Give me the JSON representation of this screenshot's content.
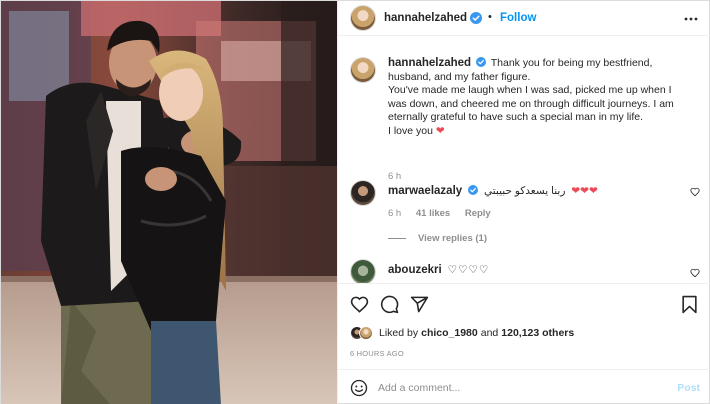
{
  "post": {
    "author": {
      "username": "hannahelzahed",
      "verified": true,
      "follow_label": "Follow",
      "separator": "•"
    },
    "caption": {
      "username": "hannahelzahed",
      "text": "Thank you for being my bestfriend, husband, and my father figure.\nYou've made me laugh when I was sad, picked me up when I was down, and cheered me on through difficult journeys. I am eternally grateful to have such a special man in my life.\nI love you",
      "emoji": "❤",
      "time": "6 h"
    },
    "comments": [
      {
        "username": "marwaelazaly",
        "verified": true,
        "text": "ربنا يسعدكو حبيبتي",
        "emoji": "❤❤❤",
        "time": "6 h",
        "likes": "41 likes",
        "reply_label": "Reply",
        "view_replies": "View replies (1)"
      },
      {
        "username": "abouzekri",
        "verified": false,
        "text": "",
        "emoji": "♡♡♡♡"
      }
    ],
    "likes": {
      "prefix": "Liked by",
      "user": "chico_1980",
      "and": "and",
      "count": "120,123 others"
    },
    "timestamp": "6 HOURS AGO",
    "add_comment": {
      "placeholder": "Add a comment...",
      "post_label": "Post"
    },
    "icons": {
      "more": "more-horizontal-icon",
      "like": "heart-icon",
      "comment": "comment-bubble-icon",
      "share": "paper-plane-icon",
      "save": "bookmark-icon",
      "emoji": "smiley-icon"
    },
    "colors": {
      "accent": "#0095f6",
      "text": "#262626",
      "muted": "#8e8e8e",
      "heart": "#ed4956",
      "post_disabled": "#b2dffc"
    }
  }
}
